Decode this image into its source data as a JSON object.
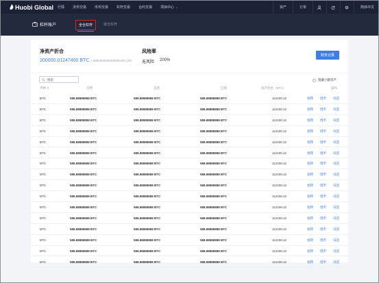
{
  "topbar": {
    "logo": "Huobi Global",
    "nav": [
      "行情",
      "法币交易",
      "币币交易",
      "杠杆交易",
      "合约交易"
    ],
    "project_center": "项目中心",
    "assets": "资产",
    "orders": "订单",
    "language": "简体中文"
  },
  "subbar": {
    "account_title": "杠杆账户",
    "tab_full": "全仓杠杆",
    "tab_isolated": "逐仓杠杆"
  },
  "summary": {
    "net_label": "净资产折合",
    "net_value": "200000.01247400 BTC",
    "net_cny": "≈ 5880000000000000.88 CNY",
    "risk_label": "风险率",
    "risk_status": "无风险",
    "risk_value": "200%",
    "record_button": "财务记录"
  },
  "table": {
    "search_placeholder": "搜索",
    "hide_small": "隐藏小额资产",
    "headers": [
      "币种 ⇕",
      "可用",
      "冻结",
      "已借",
      "资产折合（BTC）",
      "操作"
    ],
    "actions": [
      "划转",
      "借币",
      "归还"
    ],
    "rows": [
      {
        "coin": "BTC",
        "available": "588.88888888 BTC",
        "frozen": "588.88888888 BTC",
        "borrowed": "588.88888888 BTC",
        "value": "112100.12"
      },
      {
        "coin": "BTC",
        "available": "588.88888888 BTC",
        "frozen": "588.88888888 BTC",
        "borrowed": "588.88888888 BTC",
        "value": "112100.12"
      },
      {
        "coin": "BTC",
        "available": "588.88888888 BTC",
        "frozen": "588.88888888 BTC",
        "borrowed": "588.88888888 BTC",
        "value": "112100.12"
      },
      {
        "coin": "BTC",
        "available": "588.88888888 BTC",
        "frozen": "588.88888888 BTC",
        "borrowed": "588.88888888 BTC",
        "value": "112100.12"
      },
      {
        "coin": "BTC",
        "available": "588.88888888 BTC",
        "frozen": "588.88888888 BTC",
        "borrowed": "588.88888888 BTC",
        "value": "112100.12"
      },
      {
        "coin": "BTC",
        "available": "588.88888888 BTC",
        "frozen": "588.88888888 BTC",
        "borrowed": "588.88888888 BTC",
        "value": "112100.12"
      },
      {
        "coin": "BTC",
        "available": "588.88888888 BTC",
        "frozen": "588.88888888 BTC",
        "borrowed": "588.88888888 BTC",
        "value": "112100.12"
      },
      {
        "coin": "BTC",
        "available": "588.88888888 BTC",
        "frozen": "588.88888888 BTC",
        "borrowed": "588.88888888 BTC",
        "value": "112100.12"
      },
      {
        "coin": "BTC",
        "available": "588.88888888 BTC",
        "frozen": "588.88888888 BTC",
        "borrowed": "588.88888888 BTC",
        "value": "112100.12"
      },
      {
        "coin": "BTC",
        "available": "588.88888888 BTC",
        "frozen": "588.88888888 BTC",
        "borrowed": "588.88888888 BTC",
        "value": "112100.12"
      },
      {
        "coin": "BTC",
        "available": "588.88888888 BTC",
        "frozen": "588.88888888 BTC",
        "borrowed": "588.88888888 BTC",
        "value": "112100.12"
      },
      {
        "coin": "BTC",
        "available": "588.88888888 BTC",
        "frozen": "588.88888888 BTC",
        "borrowed": "588.88888888 BTC",
        "value": "112100.12"
      },
      {
        "coin": "BTC",
        "available": "588.88888888 BTC",
        "frozen": "588.88888888 BTC",
        "borrowed": "588.88888888 BTC",
        "value": "112100.12"
      },
      {
        "coin": "BTC",
        "available": "588.88888888 BTC",
        "frozen": "588.88888888 BTC",
        "borrowed": "588.88888888 BTC",
        "value": "112100.12"
      },
      {
        "coin": "BTC",
        "available": "588.88888888 BTC",
        "frozen": "588.88888888 BTC",
        "borrowed": "588.88888888 BTC",
        "value": "112100.12"
      },
      {
        "coin": "BTC",
        "available": "588.88888888 BTC",
        "frozen": "588.88888888 BTC",
        "borrowed": "588.88888888 BTC",
        "value": "112100.12"
      }
    ]
  },
  "colors": {
    "accent": "#3d7fe6",
    "topbar": "#1c2235",
    "highlight": "#e02020"
  },
  "icons": [
    "logo-icon",
    "user-icon",
    "refresh-icon",
    "gear-icon",
    "account-icon",
    "search-icon"
  ]
}
